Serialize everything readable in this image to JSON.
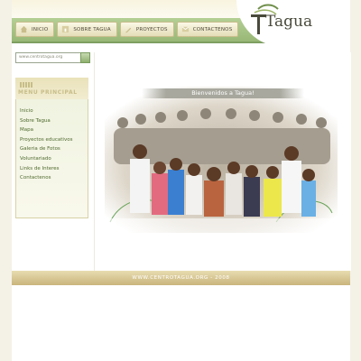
{
  "nav": {
    "items": [
      {
        "label": "INICIO",
        "icon": "house-icon"
      },
      {
        "label": "SOBRE TAGUA",
        "icon": "info-icon"
      },
      {
        "label": "PROYECTOS",
        "icon": "pencil-icon"
      },
      {
        "label": "CONTACTENOS",
        "icon": "mail-icon"
      }
    ]
  },
  "brand": {
    "name": "Tagua"
  },
  "search": {
    "value": "www.centrotagua.org"
  },
  "menu": {
    "title": "MENU PRINCIPAL",
    "items": [
      "Inicio",
      "Sobre Tagua",
      "Mapa",
      "Proyectos educativos",
      "Galeria de Fotos",
      "Voluntariado",
      "Links de Interes",
      "Contactenos"
    ]
  },
  "main": {
    "welcome": "Bienvenidos a Tagua!"
  },
  "footer": {
    "text": "WWW.CENTROTAGUA.ORG  -  2008"
  },
  "colors": {
    "accent_green": "#98b877",
    "beige": "#e9e2ba",
    "link_green": "#4e6a2e"
  }
}
